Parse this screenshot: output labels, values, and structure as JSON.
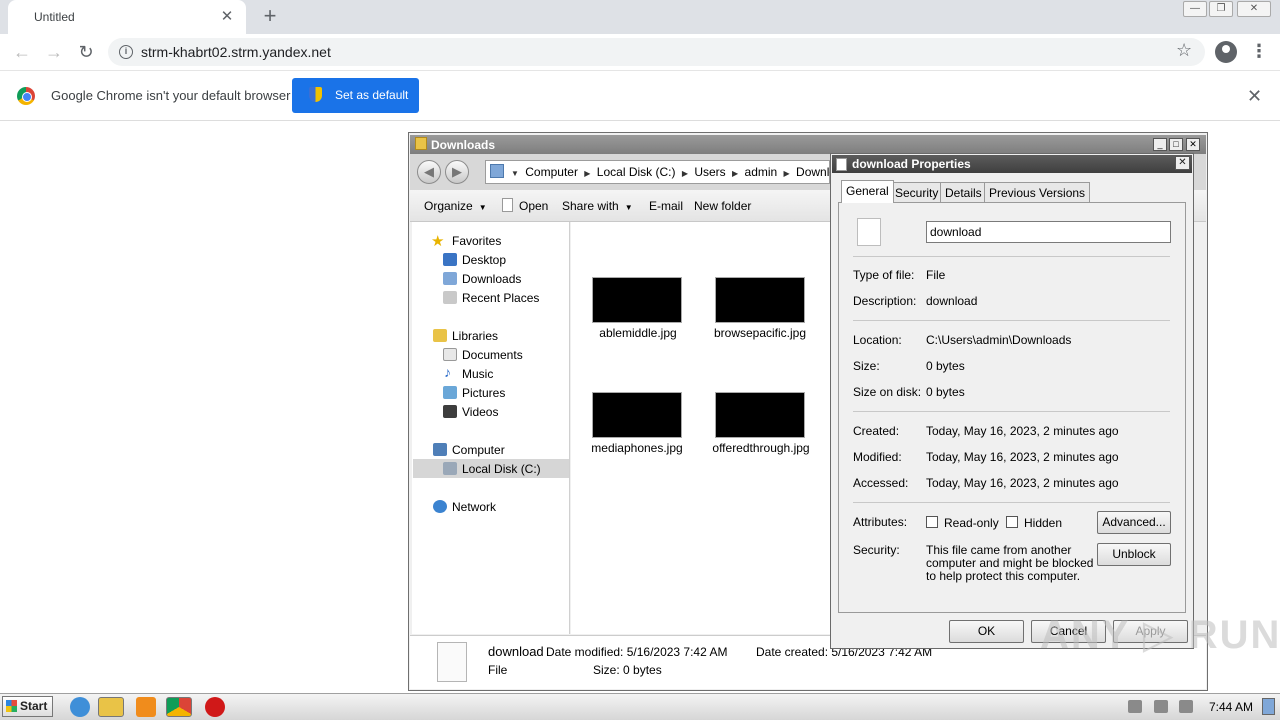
{
  "browser": {
    "tab_title": "Untitled",
    "tab_close": "✕",
    "new_tab": "+",
    "url": "strm-khabrt02.strm.yandex.net",
    "infobar_message": "Google Chrome isn't your default browser",
    "infobar_button": "Set as default",
    "infobar_close": "✕",
    "win_minimize": "—",
    "win_restore": "❐",
    "win_close": "✕"
  },
  "explorer": {
    "title": "Downloads",
    "address_crumbs": [
      "Computer",
      "Local Disk (C:)",
      "Users",
      "admin",
      "Downloads"
    ],
    "commands": {
      "organize": "Organize",
      "open": "Open",
      "share_with": "Share with",
      "email": "E-mail",
      "new_folder": "New folder"
    },
    "nav": {
      "favorites": "Favorites",
      "desktop": "Desktop",
      "downloads": "Downloads",
      "recent_places": "Recent Places",
      "libraries": "Libraries",
      "documents": "Documents",
      "music": "Music",
      "pictures": "Pictures",
      "videos": "Videos",
      "computer": "Computer",
      "local_disk": "Local Disk (C:)",
      "network": "Network"
    },
    "files": [
      "ablemiddle.jpg",
      "browsepacific.jpg",
      "mediaphones.jpg",
      "offeredthrough.jpg"
    ],
    "details": {
      "name": "download",
      "type": "File",
      "date_modified": "Date modified: 5/16/2023 7:42 AM",
      "size": "Size: 0 bytes",
      "date_created": "Date created: 5/16/2023 7:42 AM"
    }
  },
  "properties": {
    "title": "download Properties",
    "tabs": [
      "General",
      "Security",
      "Details",
      "Previous Versions"
    ],
    "file_name": "download",
    "type_of_file_label": "Type of file:",
    "type_of_file": "File",
    "description_label": "Description:",
    "description": "download",
    "location_label": "Location:",
    "location": "C:\\Users\\admin\\Downloads",
    "size_label": "Size:",
    "size": "0 bytes",
    "size_on_disk_label": "Size on disk:",
    "size_on_disk": "0 bytes",
    "created_label": "Created:",
    "created": "Today, May 16, 2023, 2 minutes ago",
    "modified_label": "Modified:",
    "modified": "Today, May 16, 2023, 2 minutes ago",
    "accessed_label": "Accessed:",
    "accessed": "Today, May 16, 2023, 2 minutes ago",
    "attributes_label": "Attributes:",
    "readonly_label": "Read-only",
    "hidden_label": "Hidden",
    "advanced_button": "Advanced...",
    "security_label": "Security:",
    "security_text": "This file came from another computer and might be blocked to help protect this computer.",
    "unblock_button": "Unblock",
    "ok_button": "OK",
    "cancel_button": "Cancel",
    "apply_button": "Apply"
  },
  "watermark": "ANY ▷ RUN",
  "taskbar": {
    "start": "Start",
    "clock": "7:44 AM"
  }
}
